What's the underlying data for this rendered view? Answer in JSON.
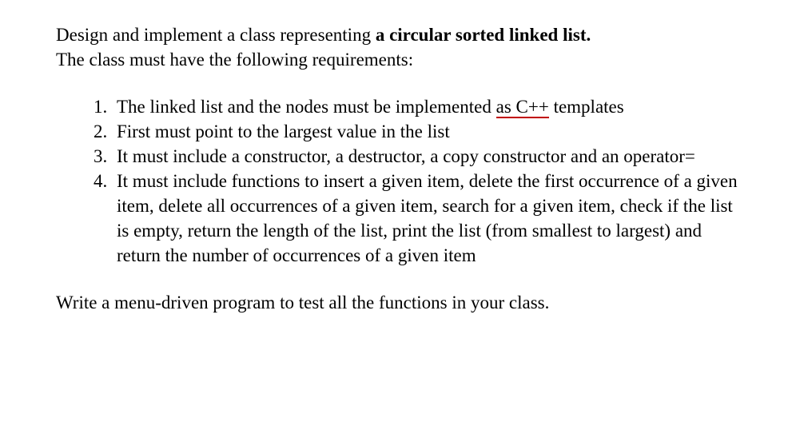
{
  "intro": {
    "pre": "Design and implement a class representing ",
    "bold": "a circular sorted linked list.",
    "line2": "The class must have the following requirements:"
  },
  "items": {
    "i1": {
      "pre": "The linked list and the nodes must be implemented ",
      "u": "as  C++",
      "post": " templates"
    },
    "i2": "First must point to the largest value in the list",
    "i3": "It must include a constructor, a destructor, a copy constructor and an operator=",
    "i4": "It must include functions to insert a given item, delete the first occurrence of a given item, delete all occurrences of a given item, search for a given item, check if the list is empty, return the length of the list, print the list (from smallest to largest) and return the number of occurrences of a given item"
  },
  "outro": "Write a menu-driven program to test all the functions in your class."
}
